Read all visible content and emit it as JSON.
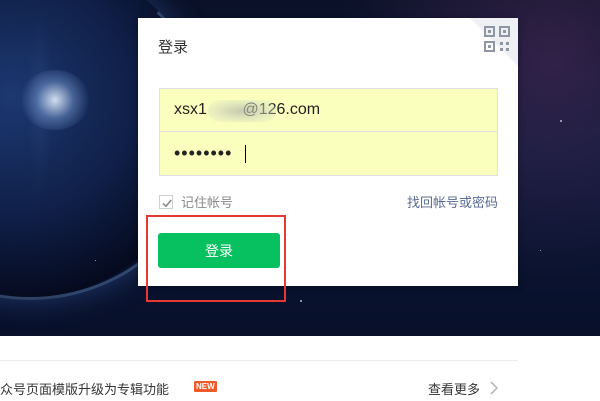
{
  "login": {
    "title": "登录",
    "account_value": "xsx1        @126.com",
    "password_value": "••••••••",
    "remember_label": "记住帐号",
    "remember_checked": true,
    "forgot_label": "找回帐号或密码",
    "submit_label": "登录"
  },
  "notice": {
    "text": "众号页面模版升级为专辑功能",
    "badge": "NEW",
    "view_more_label": "查看更多"
  },
  "colors": {
    "accent_green": "#07c160",
    "link_blue": "#576b95",
    "autofill_yellow": "#faffbd",
    "highlight_red": "#e53935",
    "badge_orange": "#f05a28"
  },
  "icons": {
    "qr": "qr-code-icon",
    "check": "checkmark-icon",
    "chevron": "chevron-right-icon"
  }
}
